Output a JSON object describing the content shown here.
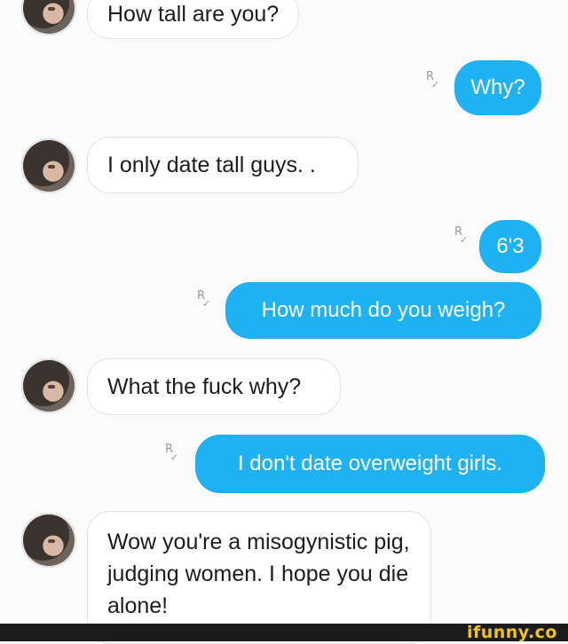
{
  "messages": [
    {
      "side": "received",
      "text": "How tall are you?"
    },
    {
      "side": "sent",
      "receipt": "R",
      "text": "Why?"
    },
    {
      "side": "received",
      "text": "I only date tall guys. ."
    },
    {
      "side": "sent",
      "receipt": "R",
      "text": "6'3"
    },
    {
      "side": "sent",
      "receipt": "R",
      "text": "How much do you weigh?"
    },
    {
      "side": "received",
      "text": "What the fuck why?"
    },
    {
      "side": "sent",
      "receipt": "R",
      "text": "I don't date overweight girls."
    },
    {
      "side": "received",
      "text": "Wow you're a misogynistic pig, judging women. I hope you die alone!"
    }
  ],
  "watermark": "ifunny.co",
  "colors": {
    "sent_bubble": "#1fb2f2",
    "received_bubble": "#ffffff",
    "watermark": "#f2c21a"
  }
}
